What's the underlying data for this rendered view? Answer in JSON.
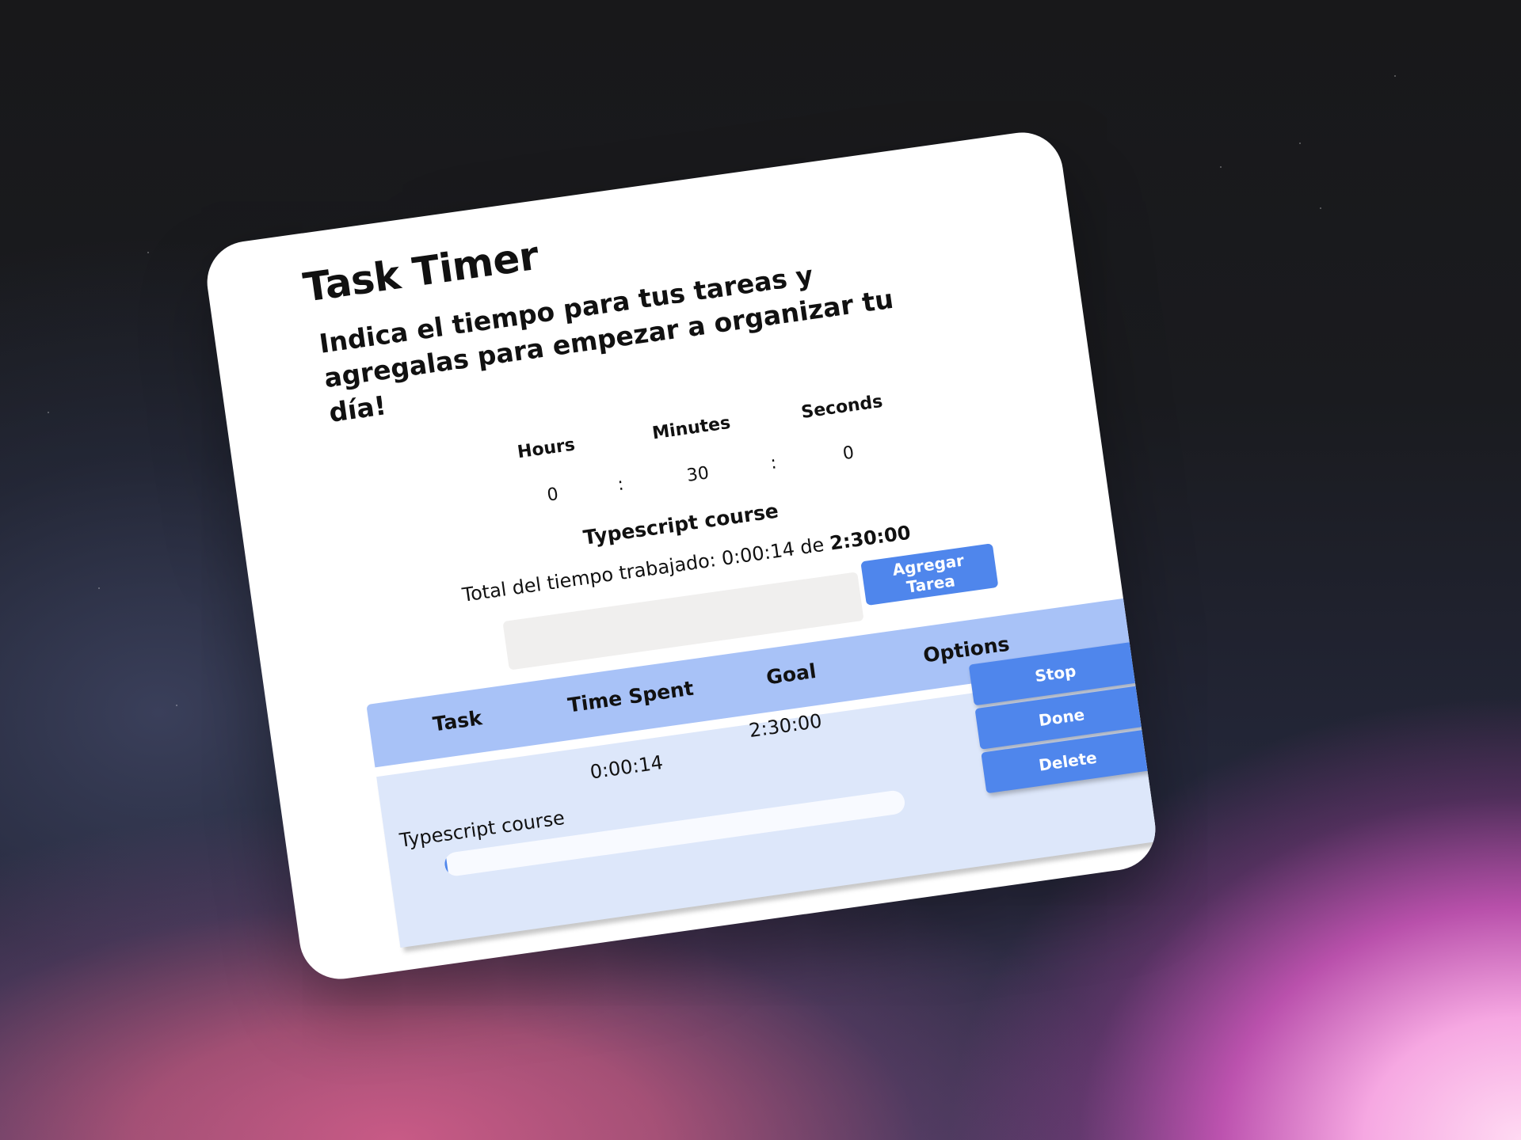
{
  "app": {
    "title": "Task Timer",
    "subtitle": "Indica el tiempo para tus tareas y agregalas para empezar a organizar tu día!"
  },
  "timer": {
    "hours_label": "Hours",
    "minutes_label": "Minutes",
    "seconds_label": "Seconds",
    "hours_value": "0",
    "minutes_value": "30",
    "seconds_value": "0",
    "separator": ":"
  },
  "current": {
    "task_name": "Typescript course",
    "total_prefix": "Total del tiempo trabajado: 0:00:14 de",
    "total_goal": "2:30:00"
  },
  "add_task": {
    "input_value": "",
    "button_label": "Agregar Tarea"
  },
  "table": {
    "headers": [
      "Task",
      "Time Spent",
      "Goal",
      "Options"
    ],
    "rows": [
      {
        "task": "Typescript course",
        "time_spent": "0:00:14",
        "goal": "2:30:00",
        "progress": 0.0016,
        "options": {
          "stop": "Stop",
          "done": "Done",
          "delete": "Delete"
        }
      }
    ]
  },
  "colors": {
    "accent": "#4f86ec",
    "table_header": "#a8c2f7",
    "row_background": "#dde7fa"
  }
}
